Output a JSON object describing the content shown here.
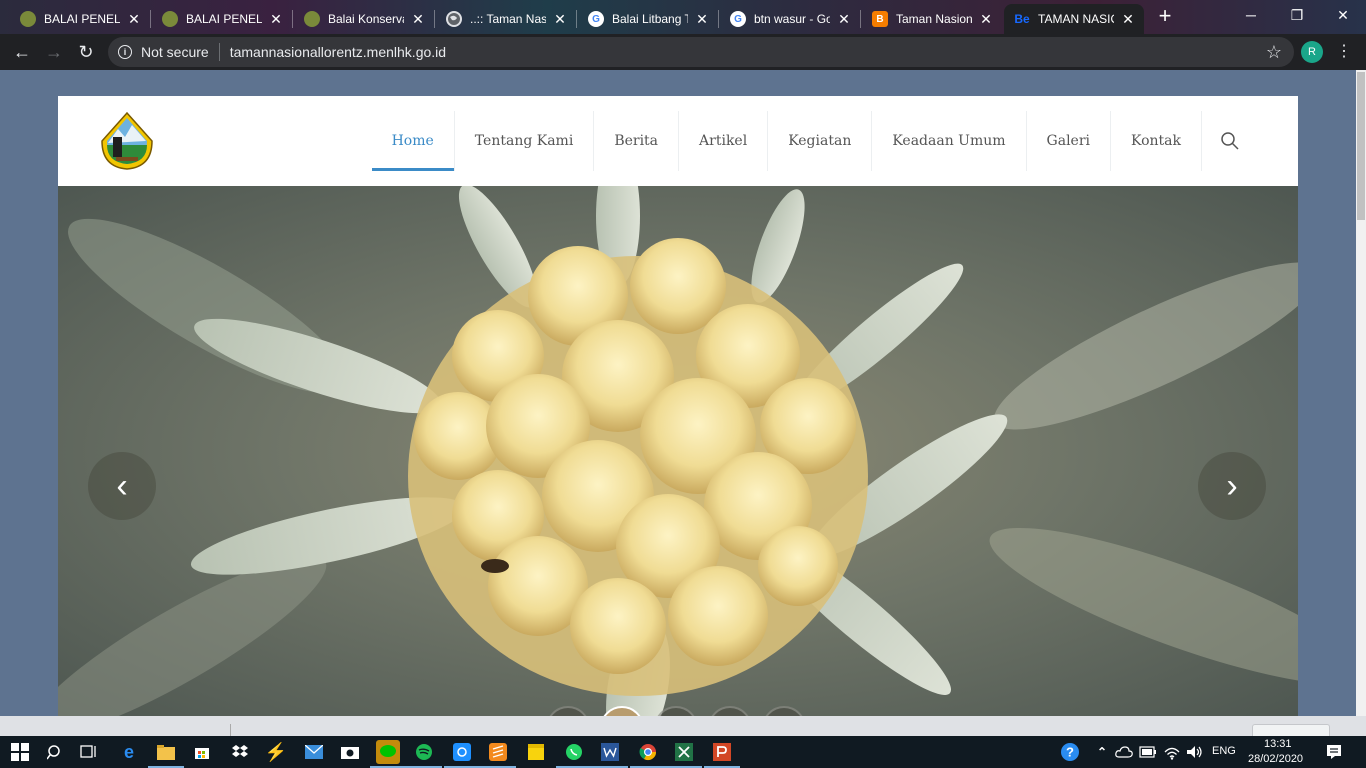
{
  "tabs": [
    {
      "title": "BALAI PENELIT",
      "favicon": "agency-emblem-icon",
      "active": false
    },
    {
      "title": "BALAI PENELIT",
      "favicon": "agency-emblem-icon",
      "active": false
    },
    {
      "title": "Balai Konserva",
      "favicon": "agency-emblem-icon",
      "active": false
    },
    {
      "title": "..:: Taman Nasio",
      "favicon": "globe-icon",
      "active": false
    },
    {
      "title": "Balai Litbang T",
      "favicon": "google-icon",
      "active": false
    },
    {
      "title": "btn wasur - Go",
      "favicon": "google-icon",
      "active": false
    },
    {
      "title": "Taman Nasion",
      "favicon": "blogger-icon",
      "active": false
    },
    {
      "title": "TAMAN NASIO",
      "favicon": "behance-icon",
      "active": true
    }
  ],
  "tab_close_glyph": "✕",
  "new_tab_glyph": "+",
  "favicon_text": {
    "google": "G",
    "blogger": "B",
    "behance": "Be"
  },
  "window_controls": {
    "minimize": "─",
    "restore": "❐",
    "close": "✕"
  },
  "toolbar": {
    "back_glyph": "←",
    "forward_glyph": "→",
    "reload_glyph": "↻",
    "security_label": "Not secure",
    "info_glyph": "i",
    "url": "tamannasionallorentz.menlhk.go.id",
    "bookmark_glyph": "☆",
    "profile_initial": "R",
    "menu_glyph": "⋮"
  },
  "site": {
    "logo": "taman-nasional-lorentz-logo",
    "nav": [
      "Home",
      "Tentang Kami",
      "Berita",
      "Artikel",
      "Kegiatan",
      "Keadaan Umum",
      "Galeri",
      "Kontak"
    ],
    "active_nav": "Home"
  },
  "slider": {
    "prev_glyph": "‹",
    "next_glyph": "›",
    "dots": 5,
    "active_dot": 2
  },
  "taskbar": {
    "apps": [
      "windows-start",
      "search",
      "task-view",
      "edge",
      "file-explorer",
      "store",
      "dropbox",
      "app-lightning",
      "mail",
      "camera",
      "line",
      "spotify",
      "app-blue",
      "sublime",
      "sticky-notes",
      "whatsapp",
      "word",
      "chrome",
      "excel",
      "powerpoint"
    ],
    "language": "ENG",
    "time": "13:31",
    "date": "28/02/2020"
  },
  "colors": {
    "accent": "#3b8bc7",
    "page_bg": "#5e7390",
    "chrome_dark": "#202124",
    "taskbar": "#101a22"
  }
}
